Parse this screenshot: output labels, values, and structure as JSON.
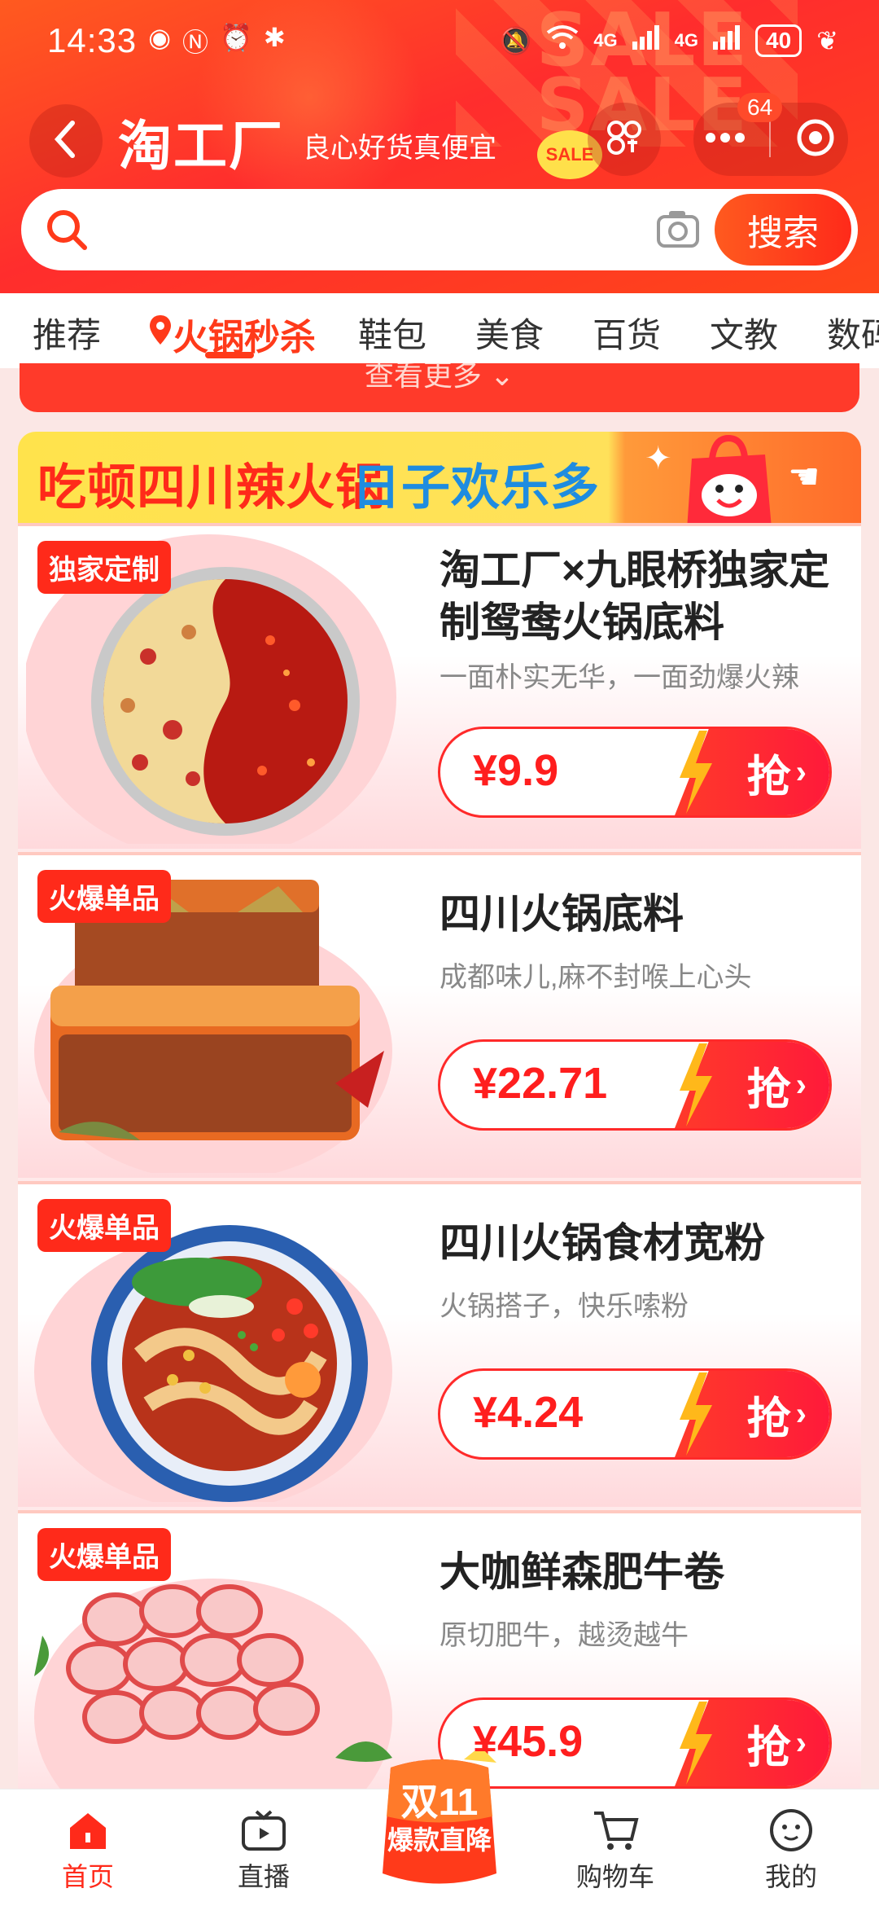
{
  "status_bar": {
    "time": "14:33",
    "network": "4G",
    "network2": "4G",
    "battery": "40"
  },
  "header": {
    "title": "淘工厂",
    "slogan": "良心好货真便宜",
    "badge": "64",
    "sale_tag": "SALE"
  },
  "search": {
    "placeholder": "",
    "button_label": "搜索"
  },
  "tabs": [
    {
      "label": "推荐"
    },
    {
      "label": "火锅秒杀"
    },
    {
      "label": "鞋包"
    },
    {
      "label": "美食"
    },
    {
      "label": "百货"
    },
    {
      "label": "文教"
    },
    {
      "label": "数码"
    }
  ],
  "more_label": "查看更多",
  "banner": {
    "title1": "吃顿四川辣火锅",
    "title2": "日子欢乐多"
  },
  "products": [
    {
      "tag": "独家定制",
      "title": "淘工厂×九眼桥独家定制鸳鸯火锅底料",
      "subtitle": "一面朴实无华，一面劲爆火辣",
      "price": "¥9.9",
      "action": "抢"
    },
    {
      "tag": "火爆单品",
      "title": "四川火锅底料",
      "subtitle": "成都味儿,麻不封喉上心头",
      "price": "¥22.71",
      "action": "抢"
    },
    {
      "tag": "火爆单品",
      "title": "四川火锅食材宽粉",
      "subtitle": "火锅搭子，快乐嗦粉",
      "price": "¥4.24",
      "action": "抢"
    },
    {
      "tag": "火爆单品",
      "title": "大咖鲜森肥牛卷",
      "subtitle": "原切肥牛，越烫越牛",
      "price": "¥45.9",
      "action": "抢"
    }
  ],
  "bottom_nav": {
    "home": "首页",
    "live": "直播",
    "promo_line1": "双11",
    "promo_line2": "爆款直降",
    "cart": "购物车",
    "mine": "我的"
  },
  "colors": {
    "brand": "#ff2a1a",
    "banner_yellow": "#ffe34c",
    "banner_blue": "#1e8ce0"
  }
}
